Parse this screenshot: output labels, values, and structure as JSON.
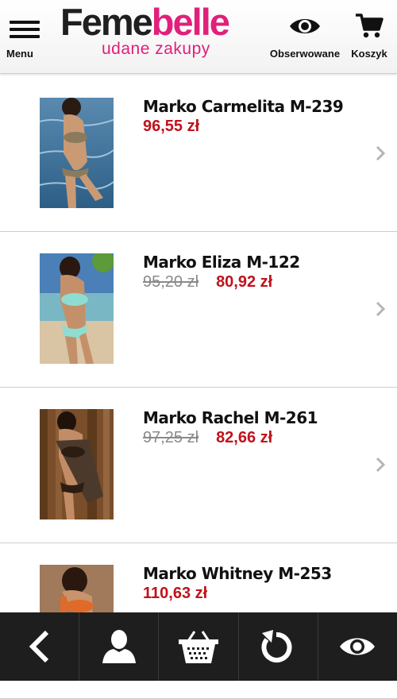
{
  "header": {
    "menu_label": "Menu",
    "logo_part1": "Feme",
    "logo_part2": "belle",
    "logo_tagline": "udane zakupy",
    "watchlist_label": "Obserwowane",
    "cart_label": "Koszyk"
  },
  "colors": {
    "brand": "#e0207a",
    "price": "#c0121c",
    "old_price": "#8a8a8a",
    "bottom_bar": "#1e1e1e"
  },
  "products": [
    {
      "name": "Marko Carmelita M-239",
      "old_price": "",
      "price": "96,55 zł",
      "image": "swimsuit-photo-taupe"
    },
    {
      "name": "Marko Eliza M-122",
      "old_price": "95,20 zł",
      "price": "80,92 zł",
      "image": "swimsuit-photo-mint"
    },
    {
      "name": "Marko Rachel M-261",
      "old_price": "97,25 zł",
      "price": "82,66 zł",
      "image": "swimsuit-photo-brown"
    },
    {
      "name": "Marko Whitney M-253",
      "old_price": "",
      "price": "110,63 zł",
      "image": "swimsuit-photo-orange"
    }
  ],
  "bottom_nav": [
    {
      "icon": "back-arrow-icon"
    },
    {
      "icon": "user-icon"
    },
    {
      "icon": "basket-icon"
    },
    {
      "icon": "refresh-icon"
    },
    {
      "icon": "eye-icon"
    }
  ]
}
